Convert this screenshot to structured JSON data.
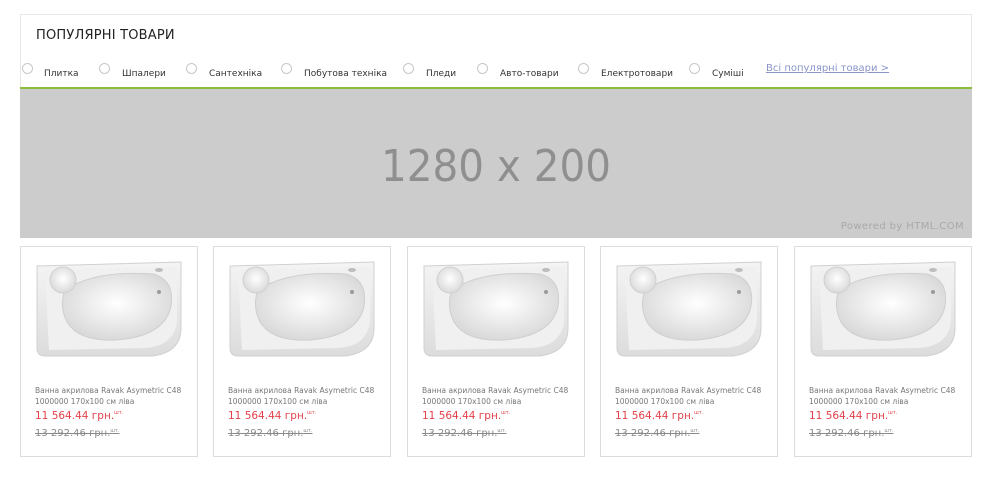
{
  "section": {
    "title": "ПОПУЛЯРНІ ТОВАРИ",
    "all_link": "Всі популярні товари >"
  },
  "tabs": [
    {
      "label": "Плитка"
    },
    {
      "label": "Шпалери"
    },
    {
      "label": "Сантехніка"
    },
    {
      "label": "Побутова техніка"
    },
    {
      "label": "Пледи"
    },
    {
      "label": "Авто-товари"
    },
    {
      "label": "Електротовари"
    },
    {
      "label": "Суміші"
    }
  ],
  "banner": {
    "text": "1280 x 200",
    "powered": "Powered by HTML.COM"
  },
  "products": [
    {
      "name": "Ванна акрилова Ravak Asymetric C48 1000000 170x100 см ліва",
      "price": "11 564.44 грн.",
      "price_unit": "шт.",
      "old_price": "13 292.46 грн.",
      "old_price_unit": "шт."
    },
    {
      "name": "Ванна акрилова Ravak Asymetric C48 1000000 170x100 см ліва",
      "price": "11 564.44 грн.",
      "price_unit": "шт.",
      "old_price": "13 292.46 грн.",
      "old_price_unit": "шт."
    },
    {
      "name": "Ванна акрилова Ravak Asymetric C48 1000000 170x100 см ліва",
      "price": "11 564.44 грн.",
      "price_unit": "шт.",
      "old_price": "13 292.46 грн.",
      "old_price_unit": "шт."
    },
    {
      "name": "Ванна акрилова Ravak Asymetric C48 1000000 170x100 см ліва",
      "price": "11 564.44 грн.",
      "price_unit": "шт.",
      "old_price": "13 292.46 грн.",
      "old_price_unit": "шт."
    },
    {
      "name": "Ванна акрилова Ravak Asymetric C48 1000000 170x100 см ліва",
      "price": "11 564.44 грн.",
      "price_unit": "шт.",
      "old_price": "13 292.46 грн.",
      "old_price_unit": "шт."
    }
  ],
  "colors": {
    "accent_green": "#8dbb3c",
    "price_red": "#e2404a",
    "link_blue": "#8a94c9",
    "banner_gray": "#cccccc"
  }
}
